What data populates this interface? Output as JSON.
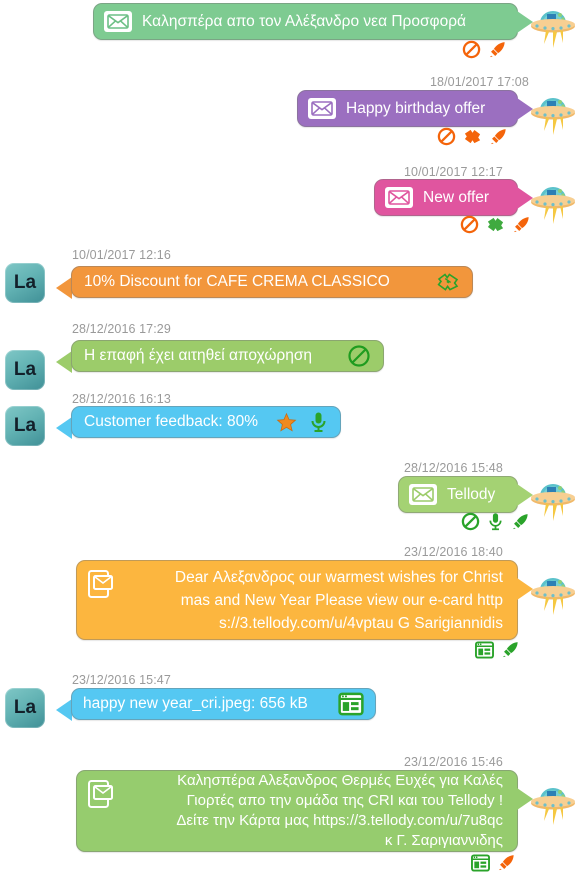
{
  "colors": {
    "bubble_green_soft": "#7ecb91",
    "bubble_purple": "#9b6fc0",
    "bubble_pink": "#e0559f",
    "bubble_orange": "#f2963c",
    "bubble_green_light": "#9ccc6a",
    "bubble_blue": "#55c8f2",
    "bubble_green_tellody": "#a4d273",
    "bubble_amber": "#fcb63f",
    "bubble_green_card": "#96cc6e",
    "timestamp_gray": "#9a9a9a",
    "accent_orange": "#f4640a",
    "accent_green": "#2aa32a",
    "avatar_teal": "#63b3b4"
  },
  "messages": [
    {
      "id": "msg-1",
      "side": "outgoing",
      "timestamp": "",
      "icon": "envelope-icon",
      "text": "Καλησπέρα απο τον Αλέξανδρο νεα Προσφορά",
      "bubble_color": "#7ecb91",
      "avatar": "ufo-avatar",
      "actions": [
        {
          "name": "block-icon",
          "color": "#f4640a"
        },
        {
          "name": "rocket-icon",
          "color": "#f4640a"
        }
      ]
    },
    {
      "id": "msg-2",
      "side": "outgoing",
      "timestamp": "18/01/2017 17:08",
      "icon": "envelope-icon",
      "text": "Happy birthday offer",
      "bubble_color": "#9b6fc0",
      "avatar": "ufo-avatar",
      "actions": [
        {
          "name": "block-icon",
          "color": "#f4640a"
        },
        {
          "name": "ticket-icon",
          "color": "#f4640a"
        },
        {
          "name": "rocket-icon",
          "color": "#f4640a"
        }
      ]
    },
    {
      "id": "msg-3",
      "side": "outgoing",
      "timestamp": "10/01/2017 12:17",
      "icon": "envelope-icon",
      "text": "New offer",
      "bubble_color": "#e0559f",
      "avatar": "ufo-avatar",
      "actions": [
        {
          "name": "block-icon",
          "color": "#f4640a"
        },
        {
          "name": "ticket-icon",
          "color": "#3faa3f"
        },
        {
          "name": "rocket-icon",
          "color": "#f4640a"
        }
      ]
    },
    {
      "id": "msg-4",
      "side": "incoming",
      "timestamp": "10/01/2017 12:16",
      "text": "10% Discount for CAFE CREMA CLASSICO",
      "trailing_icon": "ticket-outline-icon",
      "bubble_color": "#f2963c",
      "avatar": "la-avatar",
      "avatar_label": "La",
      "actions": []
    },
    {
      "id": "msg-5",
      "side": "incoming",
      "timestamp": "28/12/2016 17:29",
      "text": "Η επαφή έχει αιτηθεί αποχώρηση",
      "trailing_icon": "block-outline-icon",
      "bubble_color": "#9ccc6a",
      "avatar": "la-avatar",
      "avatar_label": "La",
      "actions": []
    },
    {
      "id": "msg-6",
      "side": "incoming",
      "timestamp": "28/12/2016 16:13",
      "text": "Customer feedback: 80%",
      "trailing_icon": "star-icon",
      "trailing_icon_2": "microphone-icon",
      "bubble_color": "#55c8f2",
      "avatar": "la-avatar",
      "avatar_label": "La",
      "actions": []
    },
    {
      "id": "msg-7",
      "side": "outgoing",
      "timestamp": "28/12/2016 15:48",
      "icon": "envelope-icon",
      "text": "Tellody",
      "bubble_color": "#a4d273",
      "avatar": "ufo-avatar",
      "actions": [
        {
          "name": "block-icon",
          "color": "#2aa32a"
        },
        {
          "name": "microphone-icon",
          "color": "#2aa32a"
        },
        {
          "name": "rocket-icon",
          "color": "#2aa32a"
        }
      ]
    },
    {
      "id": "msg-8",
      "side": "outgoing",
      "timestamp": "23/12/2016 18:40",
      "icon": "mobile-mail-icon",
      "text": "Dear Αλεξανδρος our warmest wishes for Christ\nmas and New Year Please view our e-card http\ns://3.tellody.com/u/4vptau G Sarigiannidis",
      "bubble_color": "#fcb63f",
      "avatar": "ufo-avatar",
      "actions": [
        {
          "name": "browser-window-icon",
          "color": "#2aa32a"
        },
        {
          "name": "rocket-icon",
          "color": "#2aa32a"
        }
      ]
    },
    {
      "id": "msg-9",
      "side": "incoming",
      "timestamp": "23/12/2016 15:47",
      "text": "happy new year_cri.jpeg: 656 kB",
      "trailing_icon": "browser-window-icon",
      "bubble_color": "#55c8f2",
      "avatar": "la-avatar",
      "avatar_label": "La",
      "actions": []
    },
    {
      "id": "msg-10",
      "side": "outgoing",
      "timestamp": "23/12/2016 15:46",
      "icon": "mobile-mail-icon",
      "text": "Καλησπέρα Αλεξανδρος Θερμές Ευχές για Καλές\nΓιορτές απο την ομάδα της CRI και του Tellody !\nΔείτε την Κάρτα μας https://3.tellody.com/u/7u8qc\nκ Γ. Σαριγιαννιδης",
      "bubble_color": "#96cc6e",
      "avatar": "ufo-avatar",
      "actions": [
        {
          "name": "browser-window-icon",
          "color": "#2aa32a"
        },
        {
          "name": "rocket-icon",
          "color": "#f4640a"
        }
      ]
    }
  ]
}
